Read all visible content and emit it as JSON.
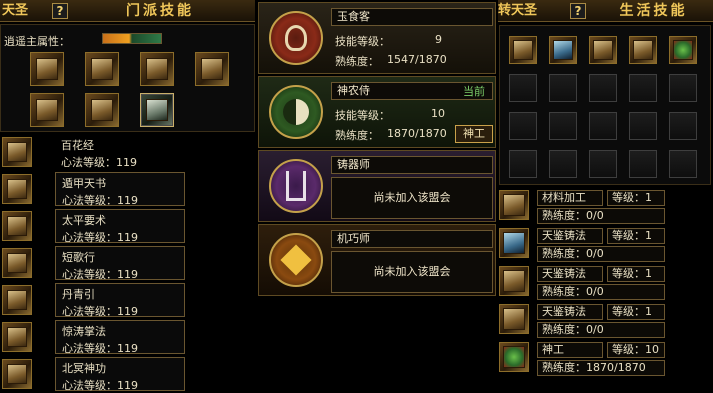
{
  "left_panel": {
    "tab_edge": "天圣",
    "help_label": "?",
    "title": "门派技能",
    "attr_label": "逍遥主属性：",
    "skills": [
      {
        "name": "百花经",
        "level": "心法等级：119"
      },
      {
        "name": "遁甲天书",
        "level": "心法等级：119"
      },
      {
        "name": "太平要术",
        "level": "心法等级：119"
      },
      {
        "name": "短歌行",
        "level": "心法等级：119"
      },
      {
        "name": "丹青引",
        "level": "心法等级：119"
      },
      {
        "name": "惊涛掌法",
        "level": "心法等级：119"
      },
      {
        "name": "北冥神功",
        "level": "心法等级：119"
      }
    ]
  },
  "middle_panel": {
    "professions": [
      {
        "name": "玉食客",
        "skill_label": "技能等级：",
        "skill_value": "9",
        "prof_label": "熟练度：",
        "prof_value": "1547/1870"
      },
      {
        "name": "神农侍",
        "badge": "当前",
        "skill_label": "技能等级：",
        "skill_value": "10",
        "prof_label": "熟练度：",
        "prof_value": "1870/1870",
        "action": "神工"
      },
      {
        "name": "铸器师",
        "status": "尚未加入该盟会"
      },
      {
        "name": "机巧师",
        "status": "尚未加入该盟会"
      }
    ]
  },
  "right_panel": {
    "tab_edge": "转天圣",
    "help_label": "?",
    "title": "生活技能",
    "rows": [
      {
        "name": "材料加工",
        "level": "等级：1",
        "prof": "熟练度：0/0"
      },
      {
        "name": "天鉴铸法",
        "level": "等级：1",
        "prof": "熟练度：0/0"
      },
      {
        "name": "天鉴铸法",
        "level": "等级：1",
        "prof": "熟练度：0/0"
      },
      {
        "name": "天鉴铸法",
        "level": "等级：1",
        "prof": "熟练度：0/0"
      },
      {
        "name": "神工",
        "level": "等级：10",
        "prof": "熟练度：1870/1870"
      }
    ]
  },
  "colors": {
    "gold": "#f0c75a",
    "border": "#6a5630",
    "current_badge": "#7ccf6a"
  }
}
